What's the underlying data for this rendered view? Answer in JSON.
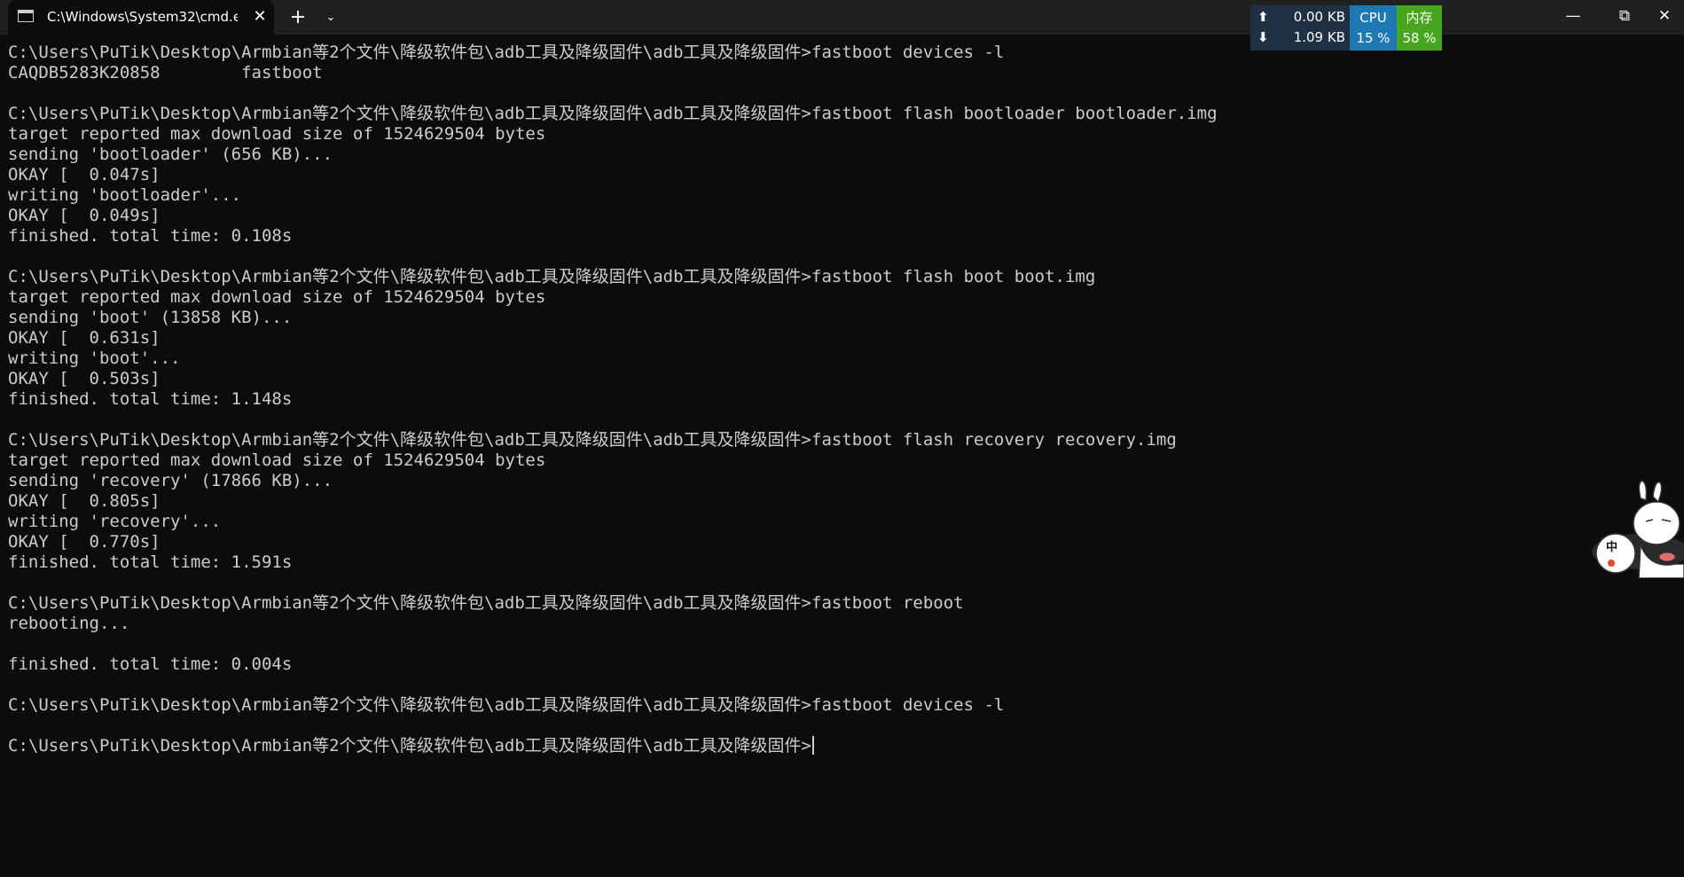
{
  "tab": {
    "title": "C:\\Windows\\System32\\cmd.e",
    "close_icon": "✕",
    "new_tab_icon": "+",
    "dropdown_icon": "⌄"
  },
  "netmon": {
    "upload": "0.00 KB",
    "download": "1.09 KB",
    "up_arrow": "⬆",
    "down_arrow": "⬇",
    "cpu_label": "CPU",
    "cpu_value": "15 %",
    "mem_label": "内存",
    "mem_value": "58 %",
    "colors": {
      "speed_bg": "#1f3042",
      "cpu_bg": "#1e78b4",
      "mem_bg": "#48a51f"
    }
  },
  "window_controls": {
    "minimize": "—",
    "maximize": "⧉",
    "close": "✕"
  },
  "ime": {
    "mode_label": "中"
  },
  "terminal": {
    "lines": [
      "C:\\Users\\PuTik\\Desktop\\Armbian等2个文件\\降级软件包\\adb工具及降级固件\\adb工具及降级固件>fastboot devices -l",
      "CAQDB5283K20858        fastboot",
      "",
      "C:\\Users\\PuTik\\Desktop\\Armbian等2个文件\\降级软件包\\adb工具及降级固件\\adb工具及降级固件>fastboot flash bootloader bootloader.img",
      "target reported max download size of 1524629504 bytes",
      "sending 'bootloader' (656 KB)...",
      "OKAY [  0.047s]",
      "writing 'bootloader'...",
      "OKAY [  0.049s]",
      "finished. total time: 0.108s",
      "",
      "C:\\Users\\PuTik\\Desktop\\Armbian等2个文件\\降级软件包\\adb工具及降级固件\\adb工具及降级固件>fastboot flash boot boot.img",
      "target reported max download size of 1524629504 bytes",
      "sending 'boot' (13858 KB)...",
      "OKAY [  0.631s]",
      "writing 'boot'...",
      "OKAY [  0.503s]",
      "finished. total time: 1.148s",
      "",
      "C:\\Users\\PuTik\\Desktop\\Armbian等2个文件\\降级软件包\\adb工具及降级固件\\adb工具及降级固件>fastboot flash recovery recovery.img",
      "target reported max download size of 1524629504 bytes",
      "sending 'recovery' (17866 KB)...",
      "OKAY [  0.805s]",
      "writing 'recovery'...",
      "OKAY [  0.770s]",
      "finished. total time: 1.591s",
      "",
      "C:\\Users\\PuTik\\Desktop\\Armbian等2个文件\\降级软件包\\adb工具及降级固件\\adb工具及降级固件>fastboot reboot",
      "rebooting...",
      "",
      "finished. total time: 0.004s",
      "",
      "C:\\Users\\PuTik\\Desktop\\Armbian等2个文件\\降级软件包\\adb工具及降级固件\\adb工具及降级固件>fastboot devices -l",
      ""
    ],
    "prompt": "C:\\Users\\PuTik\\Desktop\\Armbian等2个文件\\降级软件包\\adb工具及降级固件\\adb工具及降级固件>"
  }
}
